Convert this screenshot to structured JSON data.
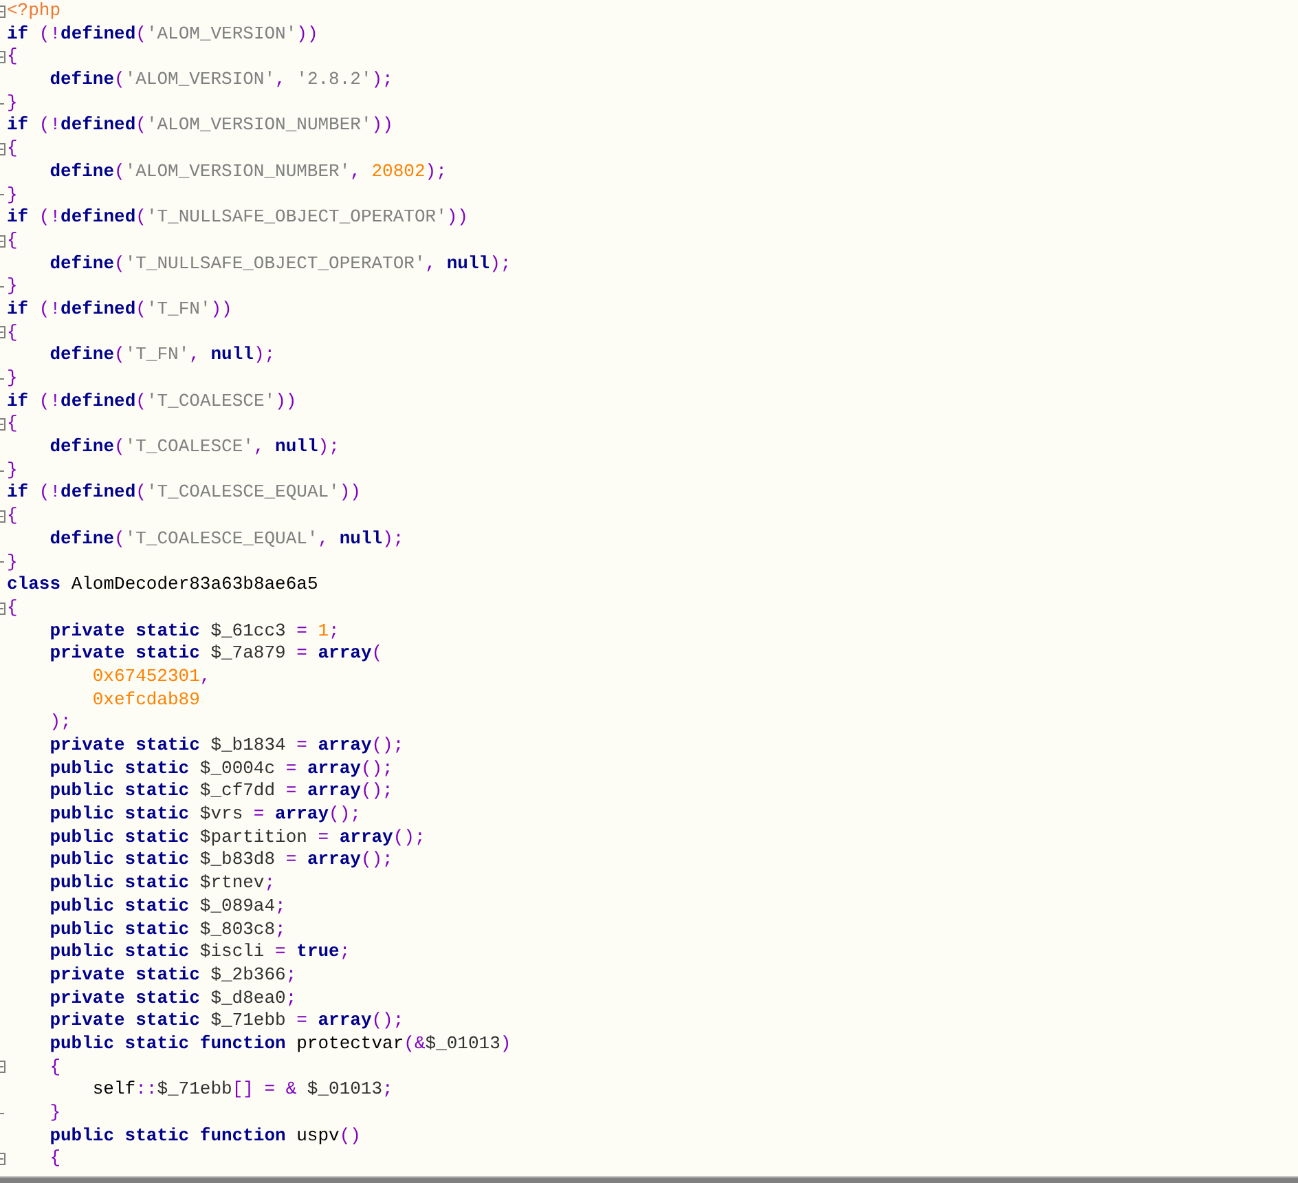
{
  "editor": {
    "lines": [
      {
        "fold_open": true,
        "fold_end": false,
        "tokens": [
          {
            "kind": "tag",
            "text": "<?php"
          }
        ]
      },
      {
        "fold_open": false,
        "fold_end": false,
        "tokens": [
          {
            "kind": "kw",
            "text": "if"
          },
          {
            "kind": "op",
            "text": " (!"
          },
          {
            "kind": "kw",
            "text": "defined"
          },
          {
            "kind": "op",
            "text": "("
          },
          {
            "kind": "str",
            "text": "'ALOM_VERSION'"
          },
          {
            "kind": "op",
            "text": "))"
          }
        ]
      },
      {
        "fold_open": true,
        "fold_end": false,
        "tokens": [
          {
            "kind": "op",
            "text": "{"
          }
        ]
      },
      {
        "fold_open": false,
        "fold_end": false,
        "tokens": [
          {
            "kind": "tab"
          },
          {
            "kind": "kw",
            "text": "define"
          },
          {
            "kind": "op",
            "text": "("
          },
          {
            "kind": "str",
            "text": "'ALOM_VERSION'"
          },
          {
            "kind": "op",
            "text": ", "
          },
          {
            "kind": "str",
            "text": "'2.8.2'"
          },
          {
            "kind": "op",
            "text": ");"
          }
        ]
      },
      {
        "fold_open": false,
        "fold_end": true,
        "tokens": [
          {
            "kind": "op",
            "text": "}"
          }
        ]
      },
      {
        "fold_open": false,
        "fold_end": false,
        "tokens": [
          {
            "kind": "kw",
            "text": "if"
          },
          {
            "kind": "op",
            "text": " (!"
          },
          {
            "kind": "kw",
            "text": "defined"
          },
          {
            "kind": "op",
            "text": "("
          },
          {
            "kind": "str",
            "text": "'ALOM_VERSION_NUMBER'"
          },
          {
            "kind": "op",
            "text": "))"
          }
        ]
      },
      {
        "fold_open": true,
        "fold_end": false,
        "tokens": [
          {
            "kind": "op",
            "text": "{"
          }
        ]
      },
      {
        "fold_open": false,
        "fold_end": false,
        "tokens": [
          {
            "kind": "tab"
          },
          {
            "kind": "kw",
            "text": "define"
          },
          {
            "kind": "op",
            "text": "("
          },
          {
            "kind": "str",
            "text": "'ALOM_VERSION_NUMBER'"
          },
          {
            "kind": "op",
            "text": ", "
          },
          {
            "kind": "num",
            "text": "20802"
          },
          {
            "kind": "op",
            "text": ");"
          }
        ]
      },
      {
        "fold_open": false,
        "fold_end": true,
        "tokens": [
          {
            "kind": "op",
            "text": "}"
          }
        ]
      },
      {
        "fold_open": false,
        "fold_end": false,
        "tokens": [
          {
            "kind": "kw",
            "text": "if"
          },
          {
            "kind": "op",
            "text": " (!"
          },
          {
            "kind": "kw",
            "text": "defined"
          },
          {
            "kind": "op",
            "text": "("
          },
          {
            "kind": "str",
            "text": "'T_NULLSAFE_OBJECT_OPERATOR'"
          },
          {
            "kind": "op",
            "text": "))"
          }
        ]
      },
      {
        "fold_open": true,
        "fold_end": false,
        "tokens": [
          {
            "kind": "op",
            "text": "{"
          }
        ]
      },
      {
        "fold_open": false,
        "fold_end": false,
        "tokens": [
          {
            "kind": "tab"
          },
          {
            "kind": "kw",
            "text": "define"
          },
          {
            "kind": "op",
            "text": "("
          },
          {
            "kind": "str",
            "text": "'T_NULLSAFE_OBJECT_OPERATOR'"
          },
          {
            "kind": "op",
            "text": ", "
          },
          {
            "kind": "kw",
            "text": "null"
          },
          {
            "kind": "op",
            "text": ");"
          }
        ]
      },
      {
        "fold_open": false,
        "fold_end": true,
        "tokens": [
          {
            "kind": "op",
            "text": "}"
          }
        ]
      },
      {
        "fold_open": false,
        "fold_end": false,
        "tokens": [
          {
            "kind": "kw",
            "text": "if"
          },
          {
            "kind": "op",
            "text": " (!"
          },
          {
            "kind": "kw",
            "text": "defined"
          },
          {
            "kind": "op",
            "text": "("
          },
          {
            "kind": "str",
            "text": "'T_FN'"
          },
          {
            "kind": "op",
            "text": "))"
          }
        ]
      },
      {
        "fold_open": true,
        "fold_end": false,
        "tokens": [
          {
            "kind": "op",
            "text": "{"
          }
        ]
      },
      {
        "fold_open": false,
        "fold_end": false,
        "tokens": [
          {
            "kind": "tab"
          },
          {
            "kind": "kw",
            "text": "define"
          },
          {
            "kind": "op",
            "text": "("
          },
          {
            "kind": "str",
            "text": "'T_FN'"
          },
          {
            "kind": "op",
            "text": ", "
          },
          {
            "kind": "kw",
            "text": "null"
          },
          {
            "kind": "op",
            "text": ");"
          }
        ]
      },
      {
        "fold_open": false,
        "fold_end": true,
        "tokens": [
          {
            "kind": "op",
            "text": "}"
          }
        ]
      },
      {
        "fold_open": false,
        "fold_end": false,
        "tokens": [
          {
            "kind": "kw",
            "text": "if"
          },
          {
            "kind": "op",
            "text": " (!"
          },
          {
            "kind": "kw",
            "text": "defined"
          },
          {
            "kind": "op",
            "text": "("
          },
          {
            "kind": "str",
            "text": "'T_COALESCE'"
          },
          {
            "kind": "op",
            "text": "))"
          }
        ]
      },
      {
        "fold_open": true,
        "fold_end": false,
        "tokens": [
          {
            "kind": "op",
            "text": "{"
          }
        ]
      },
      {
        "fold_open": false,
        "fold_end": false,
        "tokens": [
          {
            "kind": "tab"
          },
          {
            "kind": "kw",
            "text": "define"
          },
          {
            "kind": "op",
            "text": "("
          },
          {
            "kind": "str",
            "text": "'T_COALESCE'"
          },
          {
            "kind": "op",
            "text": ", "
          },
          {
            "kind": "kw",
            "text": "null"
          },
          {
            "kind": "op",
            "text": ");"
          }
        ]
      },
      {
        "fold_open": false,
        "fold_end": true,
        "tokens": [
          {
            "kind": "op",
            "text": "}"
          }
        ]
      },
      {
        "fold_open": false,
        "fold_end": false,
        "tokens": [
          {
            "kind": "kw",
            "text": "if"
          },
          {
            "kind": "op",
            "text": " (!"
          },
          {
            "kind": "kw",
            "text": "defined"
          },
          {
            "kind": "op",
            "text": "("
          },
          {
            "kind": "str",
            "text": "'T_COALESCE_EQUAL'"
          },
          {
            "kind": "op",
            "text": "))"
          }
        ]
      },
      {
        "fold_open": true,
        "fold_end": false,
        "tokens": [
          {
            "kind": "op",
            "text": "{"
          }
        ]
      },
      {
        "fold_open": false,
        "fold_end": false,
        "tokens": [
          {
            "kind": "tab"
          },
          {
            "kind": "kw",
            "text": "define"
          },
          {
            "kind": "op",
            "text": "("
          },
          {
            "kind": "str",
            "text": "'T_COALESCE_EQUAL'"
          },
          {
            "kind": "op",
            "text": ", "
          },
          {
            "kind": "kw",
            "text": "null"
          },
          {
            "kind": "op",
            "text": ");"
          }
        ]
      },
      {
        "fold_open": false,
        "fold_end": true,
        "tokens": [
          {
            "kind": "op",
            "text": "}"
          }
        ]
      },
      {
        "fold_open": false,
        "fold_end": false,
        "tokens": [
          {
            "kind": "kw",
            "text": "class"
          },
          {
            "kind": "plain",
            "text": " AlomDecoder83a63b8ae6a5"
          }
        ]
      },
      {
        "fold_open": true,
        "fold_end": false,
        "tokens": [
          {
            "kind": "op",
            "text": "{"
          }
        ]
      },
      {
        "fold_open": false,
        "fold_end": false,
        "tokens": [
          {
            "kind": "tab"
          },
          {
            "kind": "kw",
            "text": "private static"
          },
          {
            "kind": "var",
            "text": " $_61cc3 "
          },
          {
            "kind": "op",
            "text": "= "
          },
          {
            "kind": "num",
            "text": "1"
          },
          {
            "kind": "op",
            "text": ";"
          }
        ]
      },
      {
        "fold_open": false,
        "fold_end": false,
        "tokens": [
          {
            "kind": "tab"
          },
          {
            "kind": "kw",
            "text": "private static"
          },
          {
            "kind": "var",
            "text": " $_7a879 "
          },
          {
            "kind": "op",
            "text": "= "
          },
          {
            "kind": "kw",
            "text": "array"
          },
          {
            "kind": "op",
            "text": "("
          }
        ]
      },
      {
        "fold_open": false,
        "fold_end": false,
        "tokens": [
          {
            "kind": "tab"
          },
          {
            "kind": "tab"
          },
          {
            "kind": "num",
            "text": "0x67452301"
          },
          {
            "kind": "op",
            "text": ","
          }
        ]
      },
      {
        "fold_open": false,
        "fold_end": false,
        "tokens": [
          {
            "kind": "tab"
          },
          {
            "kind": "tab"
          },
          {
            "kind": "num",
            "text": "0xefcdab89"
          }
        ]
      },
      {
        "fold_open": false,
        "fold_end": false,
        "tokens": [
          {
            "kind": "tab"
          },
          {
            "kind": "op",
            "text": ");"
          }
        ]
      },
      {
        "fold_open": false,
        "fold_end": false,
        "tokens": [
          {
            "kind": "tab"
          },
          {
            "kind": "kw",
            "text": "private static"
          },
          {
            "kind": "var",
            "text": " $_b1834 "
          },
          {
            "kind": "op",
            "text": "= "
          },
          {
            "kind": "kw",
            "text": "array"
          },
          {
            "kind": "op",
            "text": "();"
          }
        ]
      },
      {
        "fold_open": false,
        "fold_end": false,
        "tokens": [
          {
            "kind": "tab"
          },
          {
            "kind": "kw",
            "text": "public static"
          },
          {
            "kind": "var",
            "text": " $_0004c "
          },
          {
            "kind": "op",
            "text": "= "
          },
          {
            "kind": "kw",
            "text": "array"
          },
          {
            "kind": "op",
            "text": "();"
          }
        ]
      },
      {
        "fold_open": false,
        "fold_end": false,
        "tokens": [
          {
            "kind": "tab"
          },
          {
            "kind": "kw",
            "text": "public static"
          },
          {
            "kind": "var",
            "text": " $_cf7dd "
          },
          {
            "kind": "op",
            "text": "= "
          },
          {
            "kind": "kw",
            "text": "array"
          },
          {
            "kind": "op",
            "text": "();"
          }
        ]
      },
      {
        "fold_open": false,
        "fold_end": false,
        "tokens": [
          {
            "kind": "tab"
          },
          {
            "kind": "kw",
            "text": "public static"
          },
          {
            "kind": "var",
            "text": " $vrs "
          },
          {
            "kind": "op",
            "text": "= "
          },
          {
            "kind": "kw",
            "text": "array"
          },
          {
            "kind": "op",
            "text": "();"
          }
        ]
      },
      {
        "fold_open": false,
        "fold_end": false,
        "tokens": [
          {
            "kind": "tab"
          },
          {
            "kind": "kw",
            "text": "public static"
          },
          {
            "kind": "var",
            "text": " $partition "
          },
          {
            "kind": "op",
            "text": "= "
          },
          {
            "kind": "kw",
            "text": "array"
          },
          {
            "kind": "op",
            "text": "();"
          }
        ]
      },
      {
        "fold_open": false,
        "fold_end": false,
        "tokens": [
          {
            "kind": "tab"
          },
          {
            "kind": "kw",
            "text": "public static"
          },
          {
            "kind": "var",
            "text": " $_b83d8 "
          },
          {
            "kind": "op",
            "text": "= "
          },
          {
            "kind": "kw",
            "text": "array"
          },
          {
            "kind": "op",
            "text": "();"
          }
        ]
      },
      {
        "fold_open": false,
        "fold_end": false,
        "tokens": [
          {
            "kind": "tab"
          },
          {
            "kind": "kw",
            "text": "public static"
          },
          {
            "kind": "var",
            "text": " $rtnev"
          },
          {
            "kind": "op",
            "text": ";"
          }
        ]
      },
      {
        "fold_open": false,
        "fold_end": false,
        "tokens": [
          {
            "kind": "tab"
          },
          {
            "kind": "kw",
            "text": "public static"
          },
          {
            "kind": "var",
            "text": " $_089a4"
          },
          {
            "kind": "op",
            "text": ";"
          }
        ]
      },
      {
        "fold_open": false,
        "fold_end": false,
        "tokens": [
          {
            "kind": "tab"
          },
          {
            "kind": "kw",
            "text": "public static"
          },
          {
            "kind": "var",
            "text": " $_803c8"
          },
          {
            "kind": "op",
            "text": ";"
          }
        ]
      },
      {
        "fold_open": false,
        "fold_end": false,
        "tokens": [
          {
            "kind": "tab"
          },
          {
            "kind": "kw",
            "text": "public static"
          },
          {
            "kind": "var",
            "text": " $iscli "
          },
          {
            "kind": "op",
            "text": "= "
          },
          {
            "kind": "kw",
            "text": "true"
          },
          {
            "kind": "op",
            "text": ";"
          }
        ]
      },
      {
        "fold_open": false,
        "fold_end": false,
        "tokens": [
          {
            "kind": "tab"
          },
          {
            "kind": "kw",
            "text": "private static"
          },
          {
            "kind": "var",
            "text": " $_2b366"
          },
          {
            "kind": "op",
            "text": ";"
          }
        ]
      },
      {
        "fold_open": false,
        "fold_end": false,
        "tokens": [
          {
            "kind": "tab"
          },
          {
            "kind": "kw",
            "text": "private static"
          },
          {
            "kind": "var",
            "text": " $_d8ea0"
          },
          {
            "kind": "op",
            "text": ";"
          }
        ]
      },
      {
        "fold_open": false,
        "fold_end": false,
        "tokens": [
          {
            "kind": "tab"
          },
          {
            "kind": "kw",
            "text": "private static"
          },
          {
            "kind": "var",
            "text": " $_71ebb "
          },
          {
            "kind": "op",
            "text": "= "
          },
          {
            "kind": "kw",
            "text": "array"
          },
          {
            "kind": "op",
            "text": "();"
          }
        ]
      },
      {
        "fold_open": false,
        "fold_end": false,
        "tokens": [
          {
            "kind": "tab"
          },
          {
            "kind": "kw",
            "text": "public static function"
          },
          {
            "kind": "plain",
            "text": " protectvar"
          },
          {
            "kind": "op",
            "text": "(&"
          },
          {
            "kind": "var",
            "text": "$_01013"
          },
          {
            "kind": "op",
            "text": ")"
          }
        ]
      },
      {
        "fold_open": true,
        "fold_end": false,
        "tokens": [
          {
            "kind": "tab"
          },
          {
            "kind": "op",
            "text": "{"
          }
        ]
      },
      {
        "fold_open": false,
        "fold_end": false,
        "tokens": [
          {
            "kind": "tab"
          },
          {
            "kind": "tab"
          },
          {
            "kind": "plain",
            "text": "self"
          },
          {
            "kind": "op",
            "text": "::"
          },
          {
            "kind": "var",
            "text": "$_71ebb"
          },
          {
            "kind": "op",
            "text": "[] = & "
          },
          {
            "kind": "var",
            "text": "$_01013"
          },
          {
            "kind": "op",
            "text": ";"
          }
        ]
      },
      {
        "fold_open": false,
        "fold_end": true,
        "tokens": [
          {
            "kind": "tab"
          },
          {
            "kind": "op",
            "text": "}"
          }
        ]
      },
      {
        "fold_open": false,
        "fold_end": false,
        "tokens": [
          {
            "kind": "tab"
          },
          {
            "kind": "kw",
            "text": "public static function"
          },
          {
            "kind": "plain",
            "text": " uspv"
          },
          {
            "kind": "op",
            "text": "()"
          }
        ]
      },
      {
        "fold_open": true,
        "fold_end": false,
        "tokens": [
          {
            "kind": "tab"
          },
          {
            "kind": "op",
            "text": "{"
          }
        ]
      }
    ]
  }
}
